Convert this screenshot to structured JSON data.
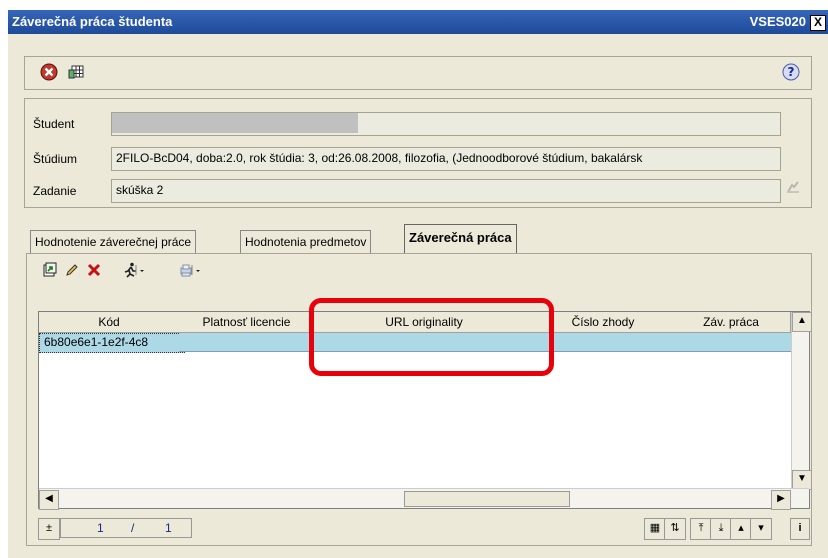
{
  "window": {
    "title": "Záverečná práca študenta",
    "code": "VSES020",
    "close_glyph": "X"
  },
  "toolbar": {
    "exit_icon": "exit-icon",
    "grid_icon": "grid-icon",
    "help_icon": "help-icon",
    "help_glyph": "?"
  },
  "form": {
    "student_label": "Študent",
    "student_value": "",
    "study_label": "Štúdium",
    "study_value": "2FILO-BcD04, doba:2.0, rok štúdia: 3, od:26.08.2008, filozofia, (Jednoodborové štúdium, bakalársk",
    "assignment_label": "Zadanie",
    "assignment_value": "skúška 2"
  },
  "tabs": [
    {
      "label": "Hodnotenie záverečnej práce"
    },
    {
      "label": "Hodnotenia predmetov"
    },
    {
      "label": "Záverečná práca",
      "active": true
    }
  ],
  "table": {
    "headers": [
      "Kód",
      "Platnosť licencie",
      "URL originality",
      "Číslo zhody",
      "Záv. práca"
    ],
    "rows": [
      [
        "6b80e6e1-1e2f-4c8",
        "",
        "",
        "",
        ""
      ]
    ]
  },
  "pager": {
    "current": "1",
    "separator": "/",
    "total": "1"
  },
  "colors": {
    "title_bar": "#1f4a9a",
    "selected_row": "#add8e6",
    "highlight": "#e8000b"
  }
}
